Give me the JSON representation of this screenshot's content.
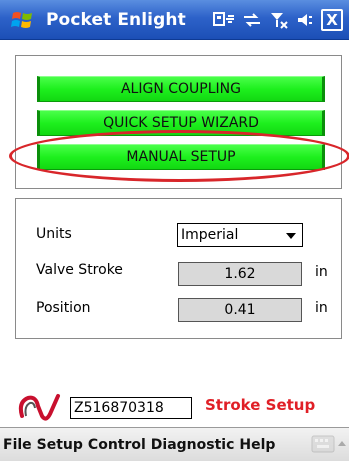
{
  "titlebar": {
    "app_title": "Pocket Enlight",
    "icons": [
      "windows-start-icon",
      "connectivity-icon",
      "sync-icon",
      "signal-icon",
      "volume-icon",
      "close-icon"
    ],
    "close_label": "X"
  },
  "actions": {
    "align_label": "ALIGN COUPLING",
    "quick_label": "QUICK SETUP WIZARD",
    "manual_label": "MANUAL SETUP",
    "button_color": "#1ef01e",
    "highlight_color": "#d8262a"
  },
  "settings": {
    "units_label": "Units",
    "units_value": "Imperial",
    "stroke_label": "Valve Stroke",
    "stroke_value": "1.62",
    "stroke_unit": "in",
    "position_label": "Position",
    "position_value": "0.41",
    "position_unit": "in"
  },
  "footer": {
    "serial": "Z516870318",
    "screen_title": "Stroke Setup",
    "title_color": "#e01f26"
  },
  "menubar": {
    "items": [
      "File",
      "Setup",
      "Control",
      "Diagnostic",
      "Help"
    ]
  }
}
